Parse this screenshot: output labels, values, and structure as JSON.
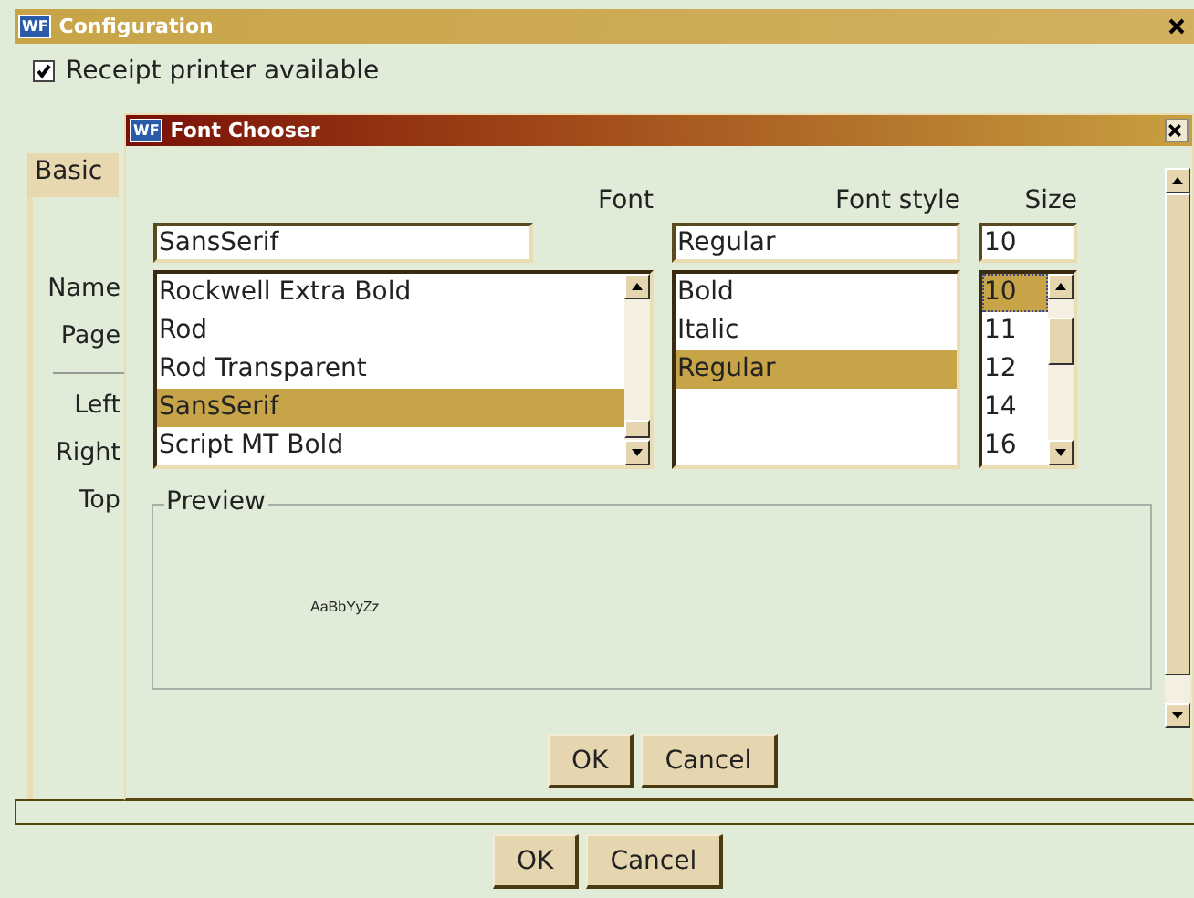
{
  "window": {
    "icon_label": "WF",
    "title": "Configuration"
  },
  "receipt_printer": {
    "label": "Receipt printer available",
    "checked": true
  },
  "tabs": [
    {
      "label": "Basic",
      "selected": true
    }
  ],
  "field_labels": [
    "Name",
    "Page"
  ],
  "margin_labels": [
    "Left",
    "Right",
    "Top"
  ],
  "font_chooser": {
    "icon_label": "WF",
    "title": "Font Chooser",
    "columns": [
      {
        "label": "Font",
        "value": "SansSerif",
        "items": [
          {
            "label": "Rockwell Extra Bold",
            "selected": false
          },
          {
            "label": "Rod",
            "selected": false
          },
          {
            "label": "Rod Transparent",
            "selected": false
          },
          {
            "label": "SansSerif",
            "selected": true
          },
          {
            "label": "Script MT Bold",
            "selected": false
          }
        ],
        "scrollbar": true
      },
      {
        "label": "Font style",
        "value": "Regular",
        "items": [
          {
            "label": "Bold",
            "selected": false
          },
          {
            "label": "Italic",
            "selected": false
          },
          {
            "label": "Regular",
            "selected": true
          }
        ],
        "scrollbar": false
      },
      {
        "label": "Size",
        "value": "10",
        "items": [
          {
            "label": "10",
            "selected": true
          },
          {
            "label": "11",
            "selected": false
          },
          {
            "label": "12",
            "selected": false
          },
          {
            "label": "14",
            "selected": false
          },
          {
            "label": "16",
            "selected": false
          }
        ],
        "scrollbar": true
      }
    ],
    "preview": {
      "label": "Preview",
      "sample": "AaBbYyZz"
    },
    "buttons": [
      "OK",
      "Cancel"
    ]
  },
  "buttons": [
    "OK",
    "Cancel"
  ]
}
